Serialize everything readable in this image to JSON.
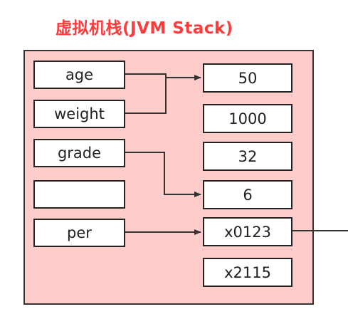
{
  "title": "虚拟机栈(JVM Stack)",
  "variables": [
    "age",
    "weight",
    "grade",
    "",
    "per"
  ],
  "values": [
    "50",
    "1000",
    "32",
    "6",
    "x0123",
    "x2115"
  ],
  "colors": {
    "title": "#ff3b3b",
    "frame_fill": "#ffcccc",
    "border": "#222222",
    "arrow": "#333333"
  }
}
